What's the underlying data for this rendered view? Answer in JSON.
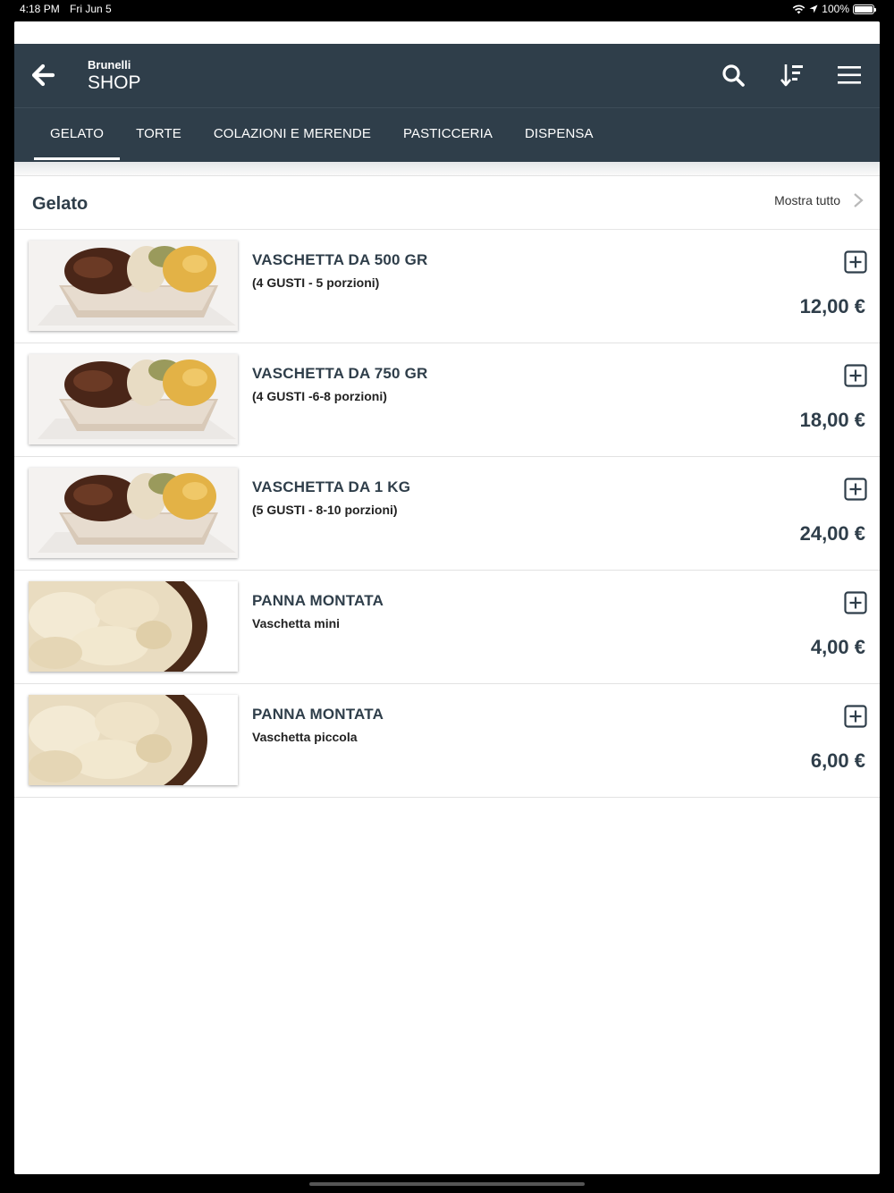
{
  "status": {
    "time": "4:18 PM",
    "date": "Fri Jun 5",
    "battery": "100%"
  },
  "header": {
    "brand_top": "Brunelli",
    "brand_bottom": "SHOP"
  },
  "tabs": [
    {
      "label": "GELATO",
      "active": true
    },
    {
      "label": "TORTE",
      "active": false
    },
    {
      "label": "COLAZIONI E MERENDE",
      "active": false
    },
    {
      "label": "PASTICCERIA",
      "active": false
    },
    {
      "label": "DISPENSA",
      "active": false
    }
  ],
  "section": {
    "title": "Gelato",
    "show_all": "Mostra tutto"
  },
  "products": [
    {
      "name": "VASCHETTA DA 500 GR",
      "desc": "(4 GUSTI - 5 porzioni)",
      "price": "12,00 €",
      "image": "gelato-tub-image"
    },
    {
      "name": "VASCHETTA DA 750 GR",
      "desc": "(4 GUSTI -6-8 porzioni)",
      "price": "18,00 €",
      "image": "gelato-tub-image"
    },
    {
      "name": "VASCHETTA DA 1 KG",
      "desc": "(5 GUSTI - 8-10 porzioni)",
      "price": "24,00 €",
      "image": "gelato-tub-image"
    },
    {
      "name": "PANNA MONTATA",
      "desc": "Vaschetta mini",
      "price": "4,00 €",
      "image": "whipped-cream-image"
    },
    {
      "name": "PANNA MONTATA",
      "desc": "Vaschetta piccola",
      "price": "6,00 €",
      "image": "whipped-cream-image"
    }
  ],
  "colors": {
    "primary": "#2f3e4a",
    "background": "#ffffff"
  }
}
